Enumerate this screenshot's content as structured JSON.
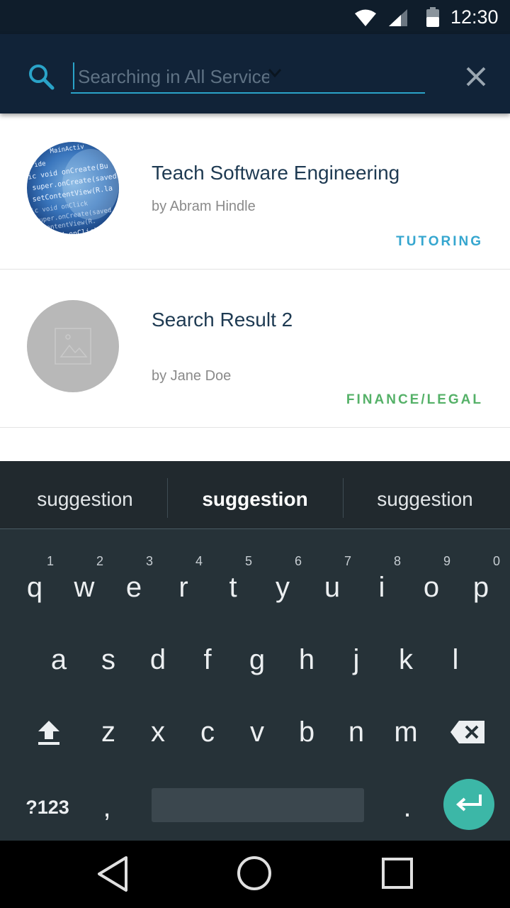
{
  "status_bar": {
    "time": "12:30",
    "icons": [
      "wifi-icon",
      "signal-icon",
      "battery-icon"
    ]
  },
  "search": {
    "placeholder": "Searching in All Services",
    "value": "",
    "icons": [
      "search-icon",
      "chevron-down-icon",
      "close-icon"
    ]
  },
  "results": [
    {
      "title": "Teach Software Engineering",
      "author": "by Abram Hindle",
      "category": "TUTORING",
      "category_color": "#35a6cf",
      "thumbnail": "code-screenshot-image",
      "thumb_lines": [
        "MainActiv",
        "ride",
        "lic void onCreate(Bu",
        "super.onCreate(saved",
        "setContentView(R.la",
        "lic void onClick",
        "super.onCreate(saved",
        "etContentView(R.",
        "void onClick"
      ]
    },
    {
      "title": "Search Result 2",
      "author": "by Jane Doe",
      "category": "FINANCE/LEGAL",
      "category_color": "#55b168",
      "thumbnail": "image-placeholder-icon"
    }
  ],
  "keyboard": {
    "suggestions": [
      "suggestion",
      "suggestion",
      "suggestion"
    ],
    "row1": [
      "q",
      "w",
      "e",
      "r",
      "t",
      "y",
      "u",
      "i",
      "o",
      "p"
    ],
    "row1_hints": [
      "1",
      "2",
      "3",
      "4",
      "5",
      "6",
      "7",
      "8",
      "9",
      "0"
    ],
    "row2": [
      "a",
      "s",
      "d",
      "f",
      "g",
      "h",
      "j",
      "k",
      "l"
    ],
    "row3": [
      "z",
      "x",
      "c",
      "v",
      "b",
      "n",
      "m"
    ],
    "row4": {
      "symbols": "?123",
      "comma": ",",
      "period": "."
    },
    "icons": [
      "shift-icon",
      "backspace-icon",
      "enter-icon"
    ],
    "enter_color": "#3cb7a7"
  },
  "nav_bar": {
    "icons": [
      "back-icon",
      "home-icon",
      "recents-icon"
    ]
  }
}
